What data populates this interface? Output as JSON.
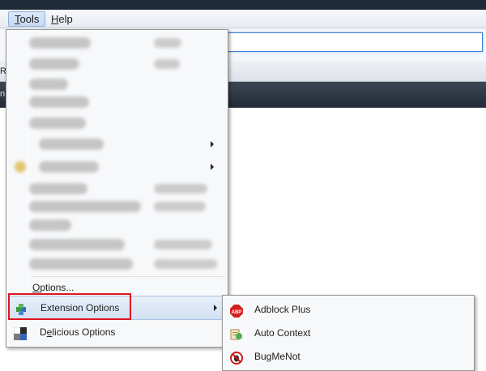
{
  "menubar": {
    "tools": {
      "accel": "T",
      "rest": "ools"
    },
    "help": {
      "accel": "H",
      "rest": "elp"
    }
  },
  "edge_letters": [
    "Ra",
    "n"
  ],
  "tools_menu": {
    "options": {
      "accel": "O",
      "rest": "ptions..."
    },
    "extension_options": "Extension Options",
    "delicious_options": {
      "accel": "e",
      "before": "D",
      "rest": "licious Options"
    }
  },
  "extension_submenu": {
    "items": [
      "Adblock Plus",
      "Auto Context",
      "BugMeNot"
    ],
    "adblock_badge": "ABP"
  },
  "colors": {
    "highlight_border": "#e0141e",
    "accent": "#3c7fd8"
  }
}
